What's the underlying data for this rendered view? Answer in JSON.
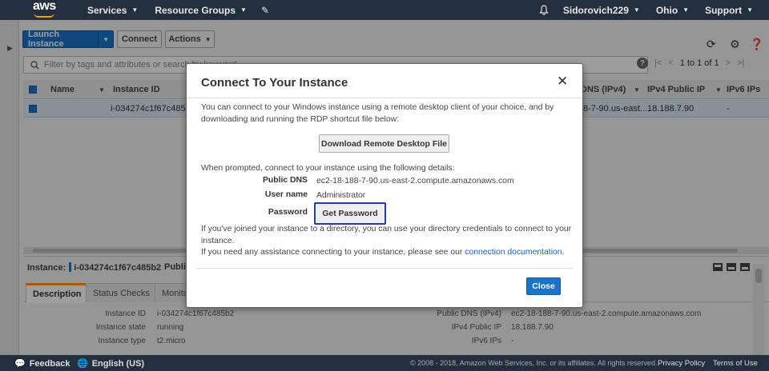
{
  "nav": {
    "logo": "aws",
    "services": "Services",
    "resource_groups": "Resource Groups",
    "user": "Sidorovich229",
    "region": "Ohio",
    "support": "Support"
  },
  "toolbar": {
    "launch_instance": "Launch Instance",
    "connect": "Connect",
    "actions": "Actions"
  },
  "search": {
    "placeholder": "Filter by tags and attributes or search by keyword"
  },
  "pager": {
    "range": "1 to 1 of 1"
  },
  "table": {
    "columns": [
      "Name",
      "Instance ID",
      "DNS (IPv4)",
      "IPv4 Public IP",
      "IPv6 IPs"
    ],
    "row": {
      "name": "",
      "instance_id": "i-034274c1f67c485b2",
      "dns_partial": "8-7-90.us-east...",
      "ipv4": "18.188.7.90",
      "ipv6": "-"
    }
  },
  "details": {
    "instance_label": "Instance:",
    "instance_id": "i-034274c1f67c485b2",
    "public_label": "Publi",
    "tabs": [
      "Description",
      "Status Checks",
      "Monito"
    ],
    "left": [
      {
        "key": "Instance ID",
        "value": "i-034274c1f67c485b2"
      },
      {
        "key": "Instance state",
        "value": "running"
      },
      {
        "key": "Instance type",
        "value": "t2.micro"
      }
    ],
    "right": [
      {
        "key": "Public DNS (IPv4)",
        "value": "ec2-18-188-7-90.us-east-2.compute.amazonaws.com"
      },
      {
        "key": "IPv4 Public IP",
        "value": "18.188.7.90"
      },
      {
        "key": "IPv6 IPs",
        "value": "-"
      }
    ]
  },
  "footer": {
    "feedback": "Feedback",
    "language": "English (US)",
    "copyright": "© 2008 - 2018, Amazon Web Services, Inc. or its affiliates. All rights reserved.",
    "privacy": "Privacy Policy",
    "terms": "Terms of Use"
  },
  "modal": {
    "title": "Connect To Your Instance",
    "intro_line1": "You can connect to your Windows instance using a remote desktop client of your choice, and by",
    "intro_line2": "downloading and running the RDP shortcut file below:",
    "download_button": "Download Remote Desktop File",
    "prompt": "When prompted, connect to your instance using the following details:",
    "public_dns_label": "Public DNS",
    "public_dns_value": "ec2-18-188-7-90.us-east-2.compute.amazonaws.com",
    "username_label": "User name",
    "username_value": "Administrator",
    "password_label": "Password",
    "get_password_button": "Get Password",
    "directory_line1": "If you've joined your instance to a directory, you can use your directory credentials to connect to your",
    "directory_line2": "instance.",
    "assist_text": "If you need any assistance connecting to your instance, please see our ",
    "assist_link": "connection documentation",
    "assist_end": ".",
    "close_button": "Close"
  }
}
